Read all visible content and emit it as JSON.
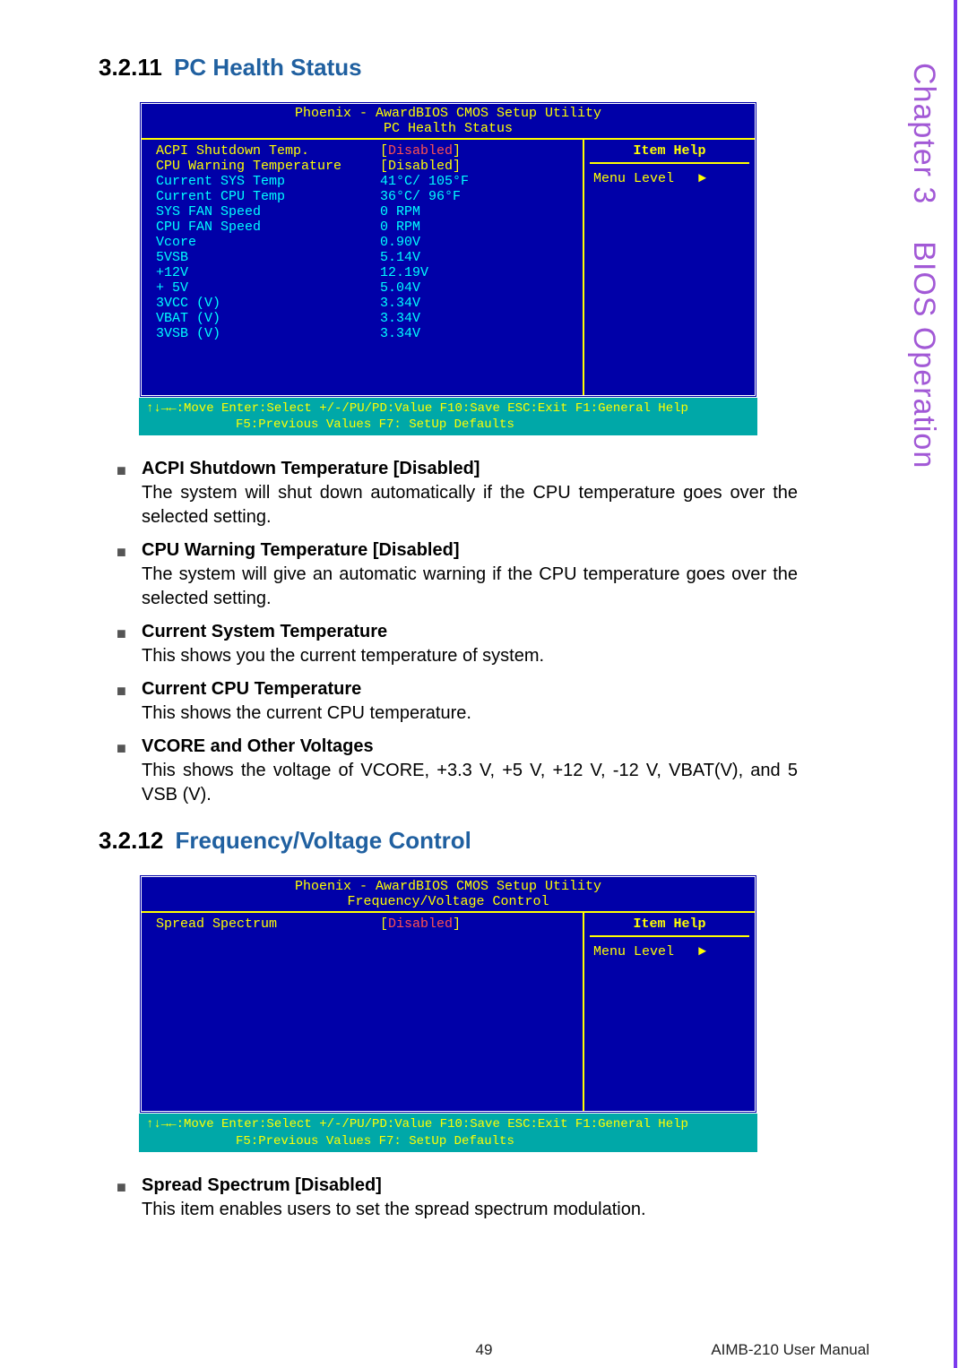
{
  "side": {
    "chapter": "Chapter 3",
    "title": "BIOS Operation"
  },
  "sec1": {
    "num": "3.2.11",
    "title": "PC Health Status"
  },
  "sec2": {
    "num": "3.2.12",
    "title": "Frequency/Voltage Control"
  },
  "bios": {
    "title": "Phoenix - AwardBIOS CMOS Setup Utility",
    "subtitle1": "PC Health Status",
    "subtitle2": "Frequency/Voltage Control",
    "item_help": "Item Help",
    "menu_level": "Menu Level",
    "footer1": "↑↓→←:Move   Enter:Select  +/-/PU/PD:Value  F10:Save  ESC:Exit  F1:General Help",
    "footer2": "F5:Previous Values                 F7: SetUp Defaults"
  },
  "pc_health_rows": [
    {
      "label": "ACPI Shutdown Temp.",
      "value_bracket_open": "[",
      "value_inner": "Disabled",
      "value_bracket_close": "]",
      "label_color": "yellow",
      "inner_red": true
    },
    {
      "label": "CPU Warning Temperature",
      "value_bracket_open": "[",
      "value_inner": "Disabled",
      "value_bracket_close": "]",
      "label_color": "yellow",
      "inner_red": false
    },
    {
      "label": "Current SYS Temp",
      "value": "41°C/ 105°F",
      "label_color": "cyan"
    },
    {
      "label": "Current CPU Temp",
      "value": "36°C/  96°F",
      "label_color": "cyan"
    },
    {
      "label": "SYS FAN Speed",
      "value": "0 RPM",
      "label_color": "cyan"
    },
    {
      "label": "CPU FAN Speed",
      "value": "0 RPM",
      "label_color": "cyan"
    },
    {
      "label": "Vcore",
      "value": "0.90V",
      "label_color": "cyan"
    },
    {
      "label": "5VSB",
      "value": "5.14V",
      "label_color": "cyan"
    },
    {
      "label": "+12V",
      "value": "12.19V",
      "label_color": "cyan"
    },
    {
      "label": "+ 5V",
      "value": "5.04V",
      "label_color": "cyan"
    },
    {
      "label": "3VCC (V)",
      "value": "3.34V",
      "label_color": "cyan"
    },
    {
      "label": "VBAT (V)",
      "value": "3.34V",
      "label_color": "cyan"
    },
    {
      "label": "3VSB (V)",
      "value": "3.34V",
      "label_color": "cyan"
    }
  ],
  "freq_rows": [
    {
      "label": "Spread Spectrum",
      "value_bracket_open": "[",
      "value_inner": "Disabled",
      "value_bracket_close": "]",
      "label_color": "yellow",
      "inner_red": true
    }
  ],
  "bullets1": [
    {
      "head": "ACPI Shutdown Temperature [Disabled]",
      "text": "The system will shut down automatically if the CPU temperature goes over the selected setting."
    },
    {
      "head": "CPU Warning Temperature [Disabled]",
      "text": "The system will give an automatic warning if the CPU temperature goes over the selected setting."
    },
    {
      "head": "Current System Temperature",
      "text": "This shows you the current temperature of system."
    },
    {
      "head": "Current CPU Temperature",
      "text": "This shows the current CPU temperature."
    },
    {
      "head": "VCORE and Other Voltages",
      "text": "This shows the voltage of VCORE, +3.3 V, +5 V, +12 V, -12 V, VBAT(V), and 5 VSB (V)."
    }
  ],
  "bullets2": [
    {
      "head": "Spread Spectrum [Disabled]",
      "text": "This item enables users to set the spread spectrum modulation."
    }
  ],
  "footer": {
    "page": "49",
    "manual": "AIMB-210 User Manual"
  }
}
